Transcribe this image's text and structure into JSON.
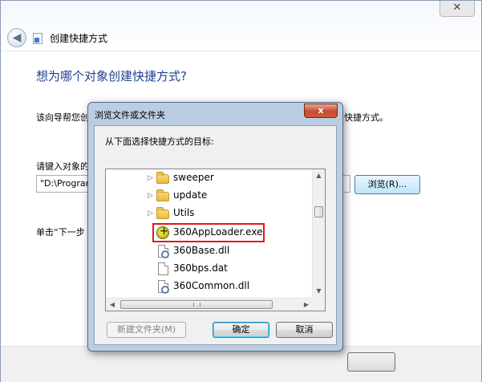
{
  "wizard": {
    "window_title": "创建快捷方式",
    "close_glyph": "✕",
    "back_glyph": "◀",
    "heading": "想为哪个对象创建快捷方式?",
    "description_start": "该向导帮您创",
    "description_end": "快捷方式。",
    "location_label": "请键入对象的",
    "location_value": "\"D:\\Program",
    "browse_button": "浏览(R)...",
    "hint": "单击“下一步"
  },
  "dialog": {
    "title": "浏览文件或文件夹",
    "close_glyph": "x",
    "prompt": "从下面选择快捷方式的目标:",
    "tree": [
      {
        "label": "sweeper",
        "type": "folder",
        "expandable": true,
        "icon": "folder-icon"
      },
      {
        "label": "update",
        "type": "folder",
        "expandable": true,
        "icon": "folder-icon"
      },
      {
        "label": "Utils",
        "type": "folder",
        "expandable": true,
        "icon": "folder-icon"
      },
      {
        "label": "360AppLoader.exe",
        "type": "exe",
        "expandable": false,
        "icon": "exe-icon",
        "highlighted": true
      },
      {
        "label": "360Base.dll",
        "type": "dll",
        "expandable": false,
        "icon": "dll-icon"
      },
      {
        "label": "360bps.dat",
        "type": "file",
        "expandable": false,
        "icon": "file-icon"
      },
      {
        "label": "360Common.dll",
        "type": "dll",
        "expandable": false,
        "icon": "dll-icon"
      }
    ],
    "expand_glyph": "▷",
    "scroll_up_glyph": "▲",
    "scroll_down_glyph": "▼",
    "scroll_left_glyph": "◀",
    "scroll_right_glyph": "▶",
    "new_folder_button": "新建文件夹(M)",
    "ok_button": "确定",
    "cancel_button": "取消",
    "highlight_color": "#e0181f"
  }
}
